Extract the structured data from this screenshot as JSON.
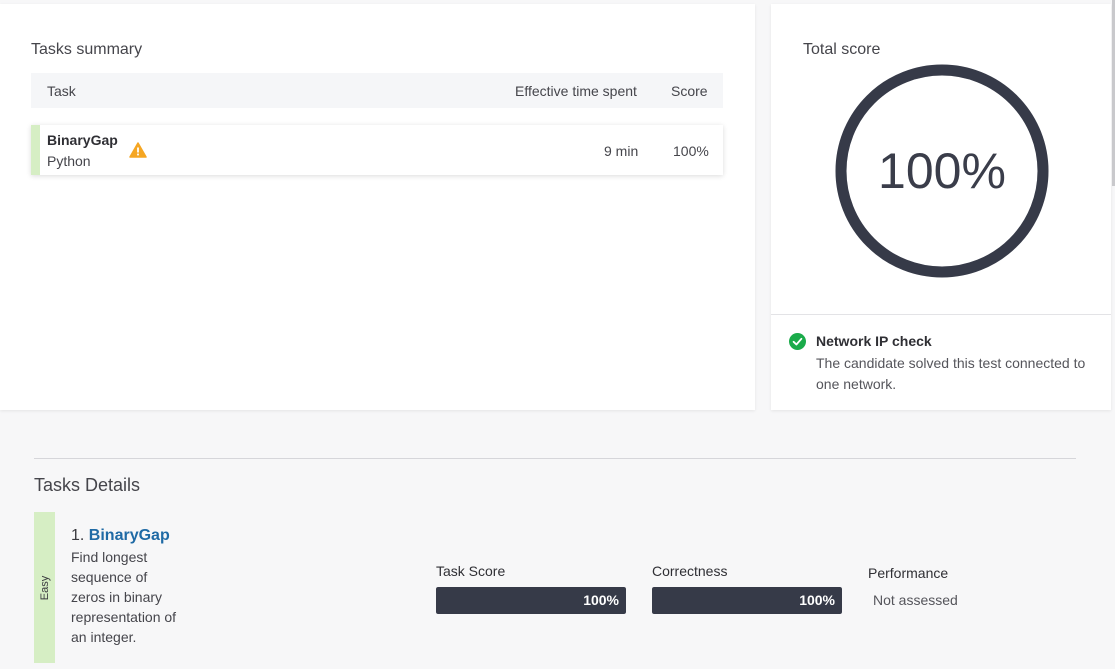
{
  "summary": {
    "title": "Tasks summary",
    "columns": {
      "task": "Task",
      "time": "Effective time spent",
      "score": "Score"
    },
    "rows": [
      {
        "name": "BinaryGap",
        "language": "Python",
        "time": "9 min",
        "score": "100%",
        "warning_icon": "warning-triangle-icon"
      }
    ]
  },
  "total_score": {
    "title": "Total score",
    "value": "100%",
    "ring_fraction": 1.0,
    "ring_color": "#363a48"
  },
  "network_check": {
    "icon": "check-circle-icon",
    "icon_color": "#1aab4a",
    "title": "Network IP check",
    "description": "The candidate solved this test connected to one network."
  },
  "details": {
    "title": "Tasks Details",
    "tasks": [
      {
        "difficulty": "Easy",
        "number": "1.",
        "name": "BinaryGap",
        "description": "Find longest sequence of zeros in binary representation of an integer.",
        "task_score": {
          "label": "Task Score",
          "value": "100%",
          "fraction": 1.0
        },
        "correctness": {
          "label": "Correctness",
          "value": "100%",
          "fraction": 1.0
        },
        "performance": {
          "label": "Performance",
          "value": "Not assessed"
        }
      }
    ]
  },
  "colors": {
    "accent_link": "#1f6aa5",
    "difficulty_easy": "#d6eec4",
    "warning": "#f5a623"
  }
}
